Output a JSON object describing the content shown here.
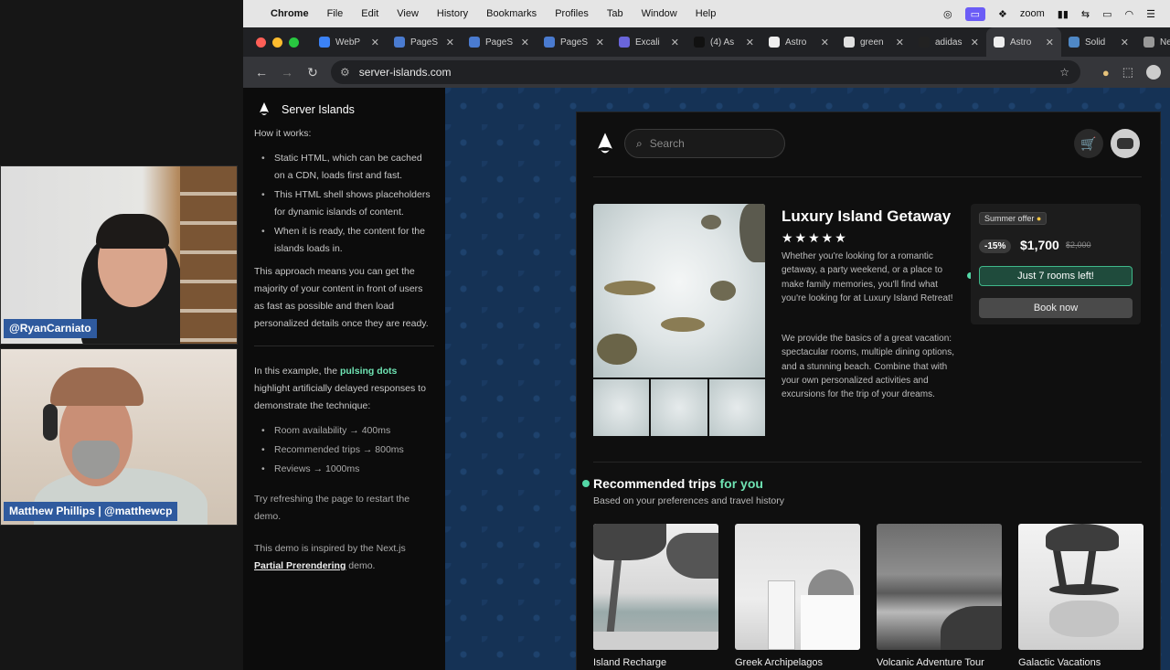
{
  "call": {
    "participants": [
      {
        "name": "@RyanCarniato"
      },
      {
        "name": "Matthew Phillips | @matthewcp"
      }
    ]
  },
  "menubar": {
    "app": "Chrome",
    "items": [
      "File",
      "Edit",
      "View",
      "History",
      "Bookmarks",
      "Profiles",
      "Tab",
      "Window",
      "Help"
    ],
    "status_zoom": "zoom"
  },
  "tabs": [
    {
      "label": "WebP",
      "color": "#3b82f6"
    },
    {
      "label": "PageS",
      "color": "#4a7bd0"
    },
    {
      "label": "PageS",
      "color": "#4a7bd0"
    },
    {
      "label": "PageS",
      "color": "#4a7bd0"
    },
    {
      "label": "Excali",
      "color": "#6965db"
    },
    {
      "label": "(4) As",
      "color": "#111111"
    },
    {
      "label": "Astro",
      "color": "#eeeeee"
    },
    {
      "label": "green",
      "color": "#e0e0e0"
    },
    {
      "label": "adidas",
      "color": "#222222"
    },
    {
      "label": "Astro",
      "color": "#eeeeee",
      "active": true
    },
    {
      "label": "Solid",
      "color": "#4f88c6"
    },
    {
      "label": "Ne",
      "color": "#999999"
    }
  ],
  "address": {
    "url": "server-islands.com"
  },
  "sidebar": {
    "title": "Server Islands",
    "how_it_works": "How it works:",
    "bullets": [
      "Static HTML, which can be cached on a CDN, loads first and fast.",
      "This HTML shell shows placeholders for dynamic islands of content.",
      "When it is ready, the content for the islands loads in."
    ],
    "approach": "This approach means you can get the majority of your content in front of users as fast as possible and then load personalized details once they are ready.",
    "example_pre": "In this example, the",
    "example_highlight": "pulsing dots",
    "example_post": "highlight artificially delayed responses to demonstrate the technique:",
    "timings": [
      "Room availability → 400ms",
      "Recommended trips → 800ms",
      "Reviews → 1000ms"
    ],
    "refresh": "Try refreshing the page to restart the demo.",
    "inspired_pre": "This demo is inspired by the Next.js",
    "inspired_link": "Partial Prerendering",
    "inspired_post": "demo."
  },
  "store": {
    "search_placeholder": "Search",
    "product": {
      "title": "Luxury Island Getaway",
      "rating": "★★★★★",
      "description1": "Whether you're looking for a romantic getaway, a party weekend, or a place to make family memories, you'll find what you're looking for at Luxury Island Retreat!",
      "description2": "We provide the basics of a great vacation: spectacular rooms, multiple dining options, and a stunning beach. Combine that with your own personalized activities and excursions for the trip of your dreams."
    },
    "offer": {
      "tag": "Summer offer",
      "discount": "-15%",
      "price": "$1,700",
      "old_price": "$2,000",
      "rooms": "Just 7 rooms left!",
      "book": "Book now"
    },
    "recommended": {
      "title_pre": "Recommended trips",
      "title_highlight": "for you",
      "subtitle": "Based on your preferences and travel history",
      "trips": [
        {
          "name": "Island Recharge"
        },
        {
          "name": "Greek Archipelagos"
        },
        {
          "name": "Volcanic Adventure Tour"
        },
        {
          "name": "Galactic Vacations"
        }
      ]
    }
  },
  "colors": {
    "accent": "#6fe3b3",
    "page_bg": "#153255",
    "name_tag": "#2f5a9e"
  }
}
